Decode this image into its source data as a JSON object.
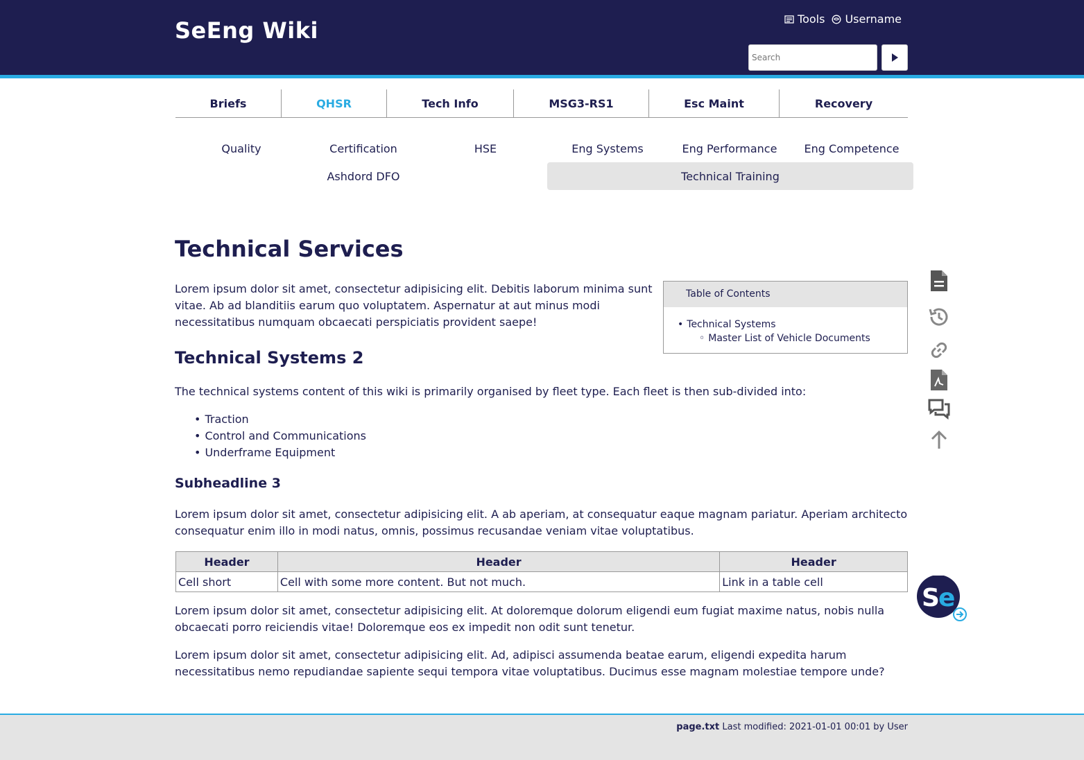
{
  "header": {
    "site_title": "SeEng Wiki",
    "tools_label": "Tools",
    "username_label": "Username",
    "search_placeholder": "Search"
  },
  "main_nav": [
    {
      "label": "Briefs",
      "active": false
    },
    {
      "label": "QHSR",
      "active": true
    },
    {
      "label": "Tech Info",
      "active": false
    },
    {
      "label": "MSG3-RS1",
      "active": false
    },
    {
      "label": "Esc Maint",
      "active": false
    },
    {
      "label": "Recovery",
      "active": false
    }
  ],
  "sub_nav": [
    {
      "label": "Quality"
    },
    {
      "label": "Certification"
    },
    {
      "label": "HSE"
    },
    {
      "label": "Eng Systems"
    },
    {
      "label": "Eng Performance"
    },
    {
      "label": "Eng Competence"
    },
    {
      "label": "Ashdord DFO"
    },
    {
      "label": "Technical Training",
      "active": true
    }
  ],
  "page": {
    "title": "Technical Services",
    "intro": "Lorem ipsum dolor sit amet, consectetur adipisicing elit. Debitis laborum minima sunt vitae. Ab ad blanditiis earum quo voluptatem. Aspernatur at aut minus modi necessitatibus numquam obcaecati perspiciatis provident saepe!",
    "h2": "Technical Systems 2",
    "systems_intro": "The technical systems content of this wiki is primarily organised by fleet type. Each fleet is then sub-divided into:",
    "bullets": [
      "Traction",
      "Control and Communications",
      "Underframe Equipment"
    ],
    "h3": "Subheadline 3",
    "para2": "Lorem ipsum dolor sit amet, consectetur adipisicing elit. A ab aperiam, at consequatur eaque magnam pariatur. Aperiam architecto consequatur enim illo in modi natus, omnis, possimus recusandae veniam vitae voluptatibus.",
    "table": {
      "headers": [
        "Header",
        "Header",
        "Header"
      ],
      "rows": [
        [
          "Cell short",
          "Cell with some more content. But not much.",
          "Link in a table cell"
        ]
      ]
    },
    "para3": "Lorem ipsum dolor sit amet, consectetur adipisicing elit. At doloremque dolorum eligendi eum fugiat maxime natus, nobis nulla obcaecati porro reiciendis vitae! Doloremque eos ex impedit non odit sunt tenetur.",
    "para4": "Lorem ipsum dolor sit amet, consectetur adipisicing elit. Ad, adipisci assumenda beatae earum, eligendi expedita harum necessitatibus nemo repudiandae sapiente sequi tempora vitae voluptatibus. Ducimus esse magnam molestiae tempore unde?"
  },
  "toc": {
    "title": "Table of Contents",
    "items": [
      {
        "label": "Technical Systems",
        "level": 1
      },
      {
        "label": "Master List of Vehicle Documents",
        "level": 2
      }
    ]
  },
  "page_tools": [
    {
      "icon": "document-icon"
    },
    {
      "icon": "history-icon"
    },
    {
      "icon": "link-icon"
    },
    {
      "icon": "pdf-icon"
    },
    {
      "icon": "discussion-icon"
    },
    {
      "icon": "back-to-top-icon"
    }
  ],
  "logo": {
    "text_s": "S",
    "text_e": "e"
  },
  "footer": {
    "filename": "page.txt",
    "last_modified": "Last modified: 2021-01-01 00:01 by User"
  },
  "colors": {
    "navy": "#1e1e50",
    "accent": "#29abe2",
    "panel_gray": "#e4e4e4"
  }
}
